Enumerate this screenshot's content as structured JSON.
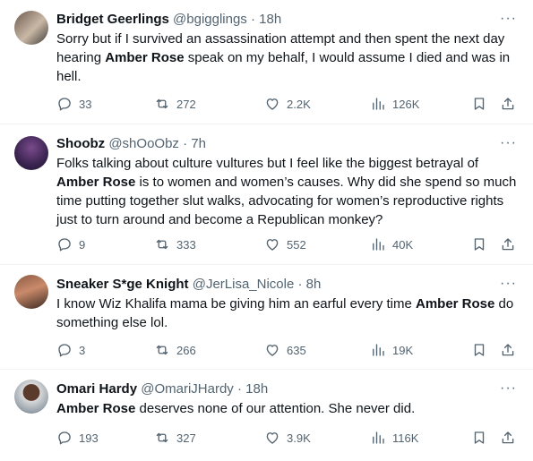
{
  "tweets": [
    {
      "name": "Bridget Geerlings",
      "handle": "@bgigglings",
      "time": "· 18h",
      "avatar_icon": "avatar-photo-bridget",
      "segments": [
        {
          "text": "Sorry but if I survived an assassination attempt and then spent the next day hearing ",
          "bold": false
        },
        {
          "text": "Amber Rose",
          "bold": true
        },
        {
          "text": " speak on my behalf, I would assume I died and was in hell.",
          "bold": false
        }
      ],
      "replies": "33",
      "retweets": "272",
      "likes": "2.2K",
      "views": "126K"
    },
    {
      "name": "Shoobz",
      "handle": "@shOoObz",
      "time": "· 7h",
      "avatar_icon": "avatar-photo-shoobz",
      "segments": [
        {
          "text": "Folks talking about culture vultures but I feel like the biggest betrayal of ",
          "bold": false
        },
        {
          "text": "Amber Rose",
          "bold": true
        },
        {
          "text": " is to women and women’s causes. Why did she spend so much time putting together slut walks, advocating for women’s reproductive rights just to turn around and become a Republican monkey?",
          "bold": false
        }
      ],
      "replies": "9",
      "retweets": "333",
      "likes": "552",
      "views": "40K"
    },
    {
      "name": "Sneaker S*ge Knight",
      "handle": "@JerLisa_Nicole",
      "time": "· 8h",
      "avatar_icon": "avatar-photo-sneaker",
      "segments": [
        {
          "text": "I know Wiz Khalifa mama be giving him an earful every time ",
          "bold": false
        },
        {
          "text": "Amber Rose",
          "bold": true
        },
        {
          "text": " do something else lol.",
          "bold": false
        }
      ],
      "replies": "3",
      "retweets": "266",
      "likes": "635",
      "views": "19K"
    },
    {
      "name": "Omari Hardy",
      "handle": "@OmariJHardy",
      "time": "· 18h",
      "avatar_icon": "avatar-photo-omari",
      "segments": [
        {
          "text": "Amber Rose",
          "bold": true
        },
        {
          "text": " deserves none of our attention. She never did.",
          "bold": false
        }
      ],
      "replies": "193",
      "retweets": "327",
      "likes": "3.9K",
      "views": "116K"
    }
  ],
  "icons": {
    "more": "more-horizontal-icon",
    "reply": "reply-icon",
    "retweet": "retweet-icon",
    "like": "heart-icon",
    "views": "views-bar-chart-icon",
    "bookmark": "bookmark-icon",
    "share": "share-icon"
  },
  "more_glyph": "···",
  "colors": {
    "text": "#0f1419",
    "secondary": "#536471",
    "divider": "#eff3f4"
  }
}
